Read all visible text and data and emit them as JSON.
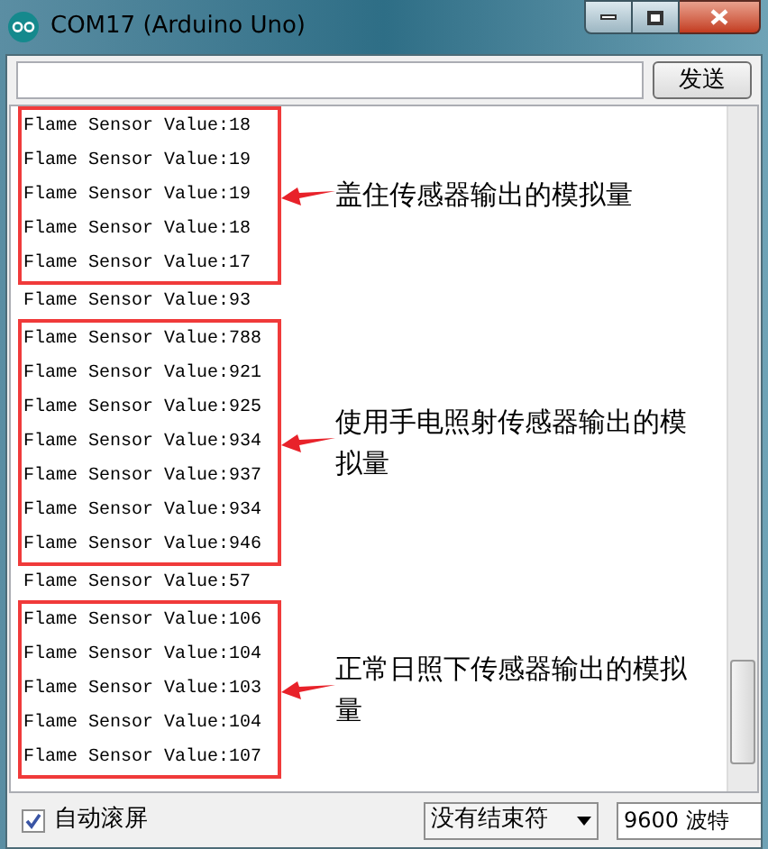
{
  "window": {
    "title": "COM17 (Arduino Uno)"
  },
  "send_button": "发送",
  "output": [
    {
      "kind": "annotated",
      "lines": [
        "Flame Sensor Value:18",
        "Flame Sensor Value:19",
        "Flame Sensor Value:19",
        "Flame Sensor Value:18",
        "Flame Sensor Value:17"
      ],
      "note": "盖住传感器输出的模拟量"
    },
    {
      "kind": "plain",
      "lines": [
        "Flame Sensor Value:93"
      ]
    },
    {
      "kind": "annotated",
      "lines": [
        "Flame Sensor Value:788",
        "Flame Sensor Value:921",
        "Flame Sensor Value:925",
        "Flame Sensor Value:934",
        "Flame Sensor Value:937",
        "Flame Sensor Value:934",
        "Flame Sensor Value:946"
      ],
      "note": "使用手电照射传感器输出的模拟量"
    },
    {
      "kind": "plain",
      "lines": [
        "Flame Sensor Value:57"
      ]
    },
    {
      "kind": "annotated",
      "lines": [
        "Flame Sensor Value:106",
        "Flame Sensor Value:104",
        "Flame Sensor Value:103",
        "Flame Sensor Value:104",
        "Flame Sensor Value:107"
      ],
      "note": "正常日照下传感器输出的模拟量"
    }
  ],
  "autoscroll": {
    "label": "自动滚屏",
    "checked": true
  },
  "line_ending": "没有结束符",
  "baud_rate": "9600 波特"
}
